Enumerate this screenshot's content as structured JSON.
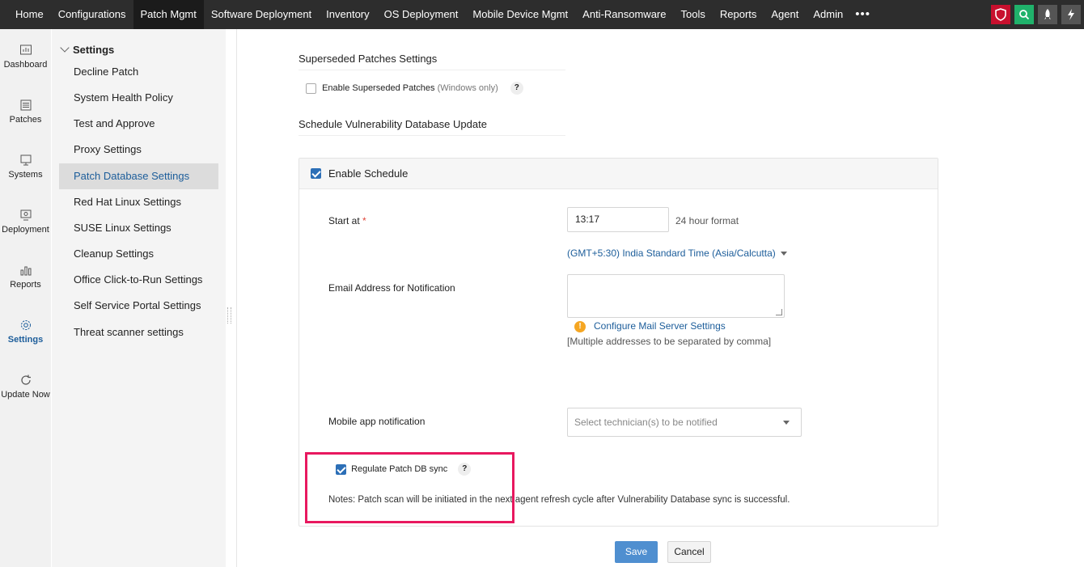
{
  "topnav": {
    "items": [
      "Home",
      "Configurations",
      "Patch Mgmt",
      "Software Deployment",
      "Inventory",
      "OS Deployment",
      "Mobile Device Mgmt",
      "Anti-Ransomware",
      "Tools",
      "Reports",
      "Agent",
      "Admin"
    ],
    "active_index": 2,
    "more": "•••",
    "right_icons": [
      "shield-icon",
      "search-icon",
      "rocket-icon",
      "bolt-icon"
    ]
  },
  "rail": {
    "items": [
      {
        "label": "Dashboard",
        "icon": "dashboard-icon"
      },
      {
        "label": "Patches",
        "icon": "patches-icon"
      },
      {
        "label": "Systems",
        "icon": "systems-icon"
      },
      {
        "label": "Deployment",
        "icon": "deployment-icon"
      },
      {
        "label": "Reports",
        "icon": "reports-icon"
      },
      {
        "label": "Settings",
        "icon": "settings-icon"
      },
      {
        "label": "Update Now",
        "icon": "refresh-icon"
      }
    ],
    "active_index": 5
  },
  "menu": {
    "title": "Settings",
    "items": [
      "Decline Patch",
      "System Health Policy",
      "Test and Approve",
      "Proxy Settings",
      "Patch Database Settings",
      "Red Hat Linux Settings",
      "SUSE Linux Settings",
      "Cleanup Settings",
      "Office Click-to-Run Settings",
      "Self Service Portal Settings",
      "Threat scanner settings"
    ],
    "active_index": 4
  },
  "superseded": {
    "title": "Superseded Patches Settings",
    "checkbox_label": "Enable Superseded Patches",
    "checkbox_note": "(Windows only)",
    "checked": false
  },
  "schedule": {
    "title": "Schedule Vulnerability Database Update",
    "enable_label": "Enable Schedule",
    "enabled": true,
    "start_label": "Start at",
    "required_mark": "*",
    "start_value": "13:17",
    "time_format_hint": "24 hour format",
    "timezone": "(GMT+5:30) India Standard Time (Asia/Calcutta)",
    "email_label": "Email Address for Notification",
    "email_value": "",
    "configure_mail_link": "Configure Mail Server Settings",
    "email_hint": "[Multiple addresses to be separated by comma]",
    "mobile_label": "Mobile app notification",
    "mobile_placeholder": "Select technician(s) to be notified",
    "regulate_label": "Regulate Patch DB sync",
    "regulate_checked": true,
    "note": "Notes: Patch scan will be initiated in the next agent refresh cycle after Vulnerability Database sync is successful."
  },
  "actions": {
    "save": "Save",
    "cancel": "Cancel"
  },
  "help_glyph": "?",
  "colors": {
    "accent": "#1c5d9a",
    "highlight": "#e8185f",
    "primary_button": "#4f8fd0"
  }
}
